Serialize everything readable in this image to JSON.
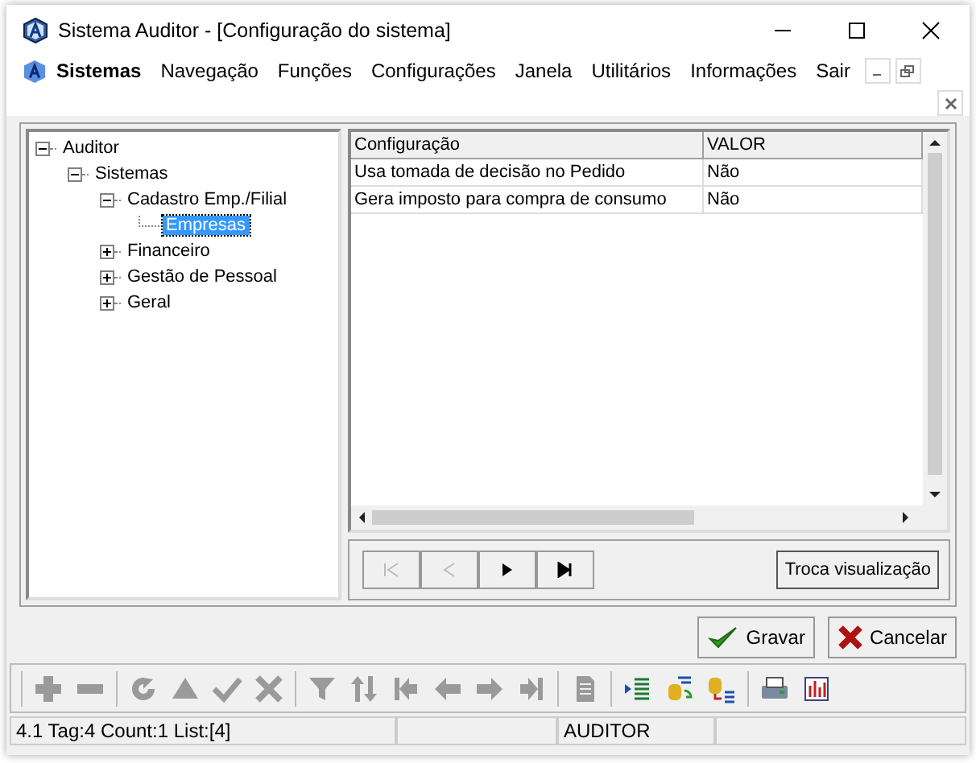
{
  "window": {
    "title": "Sistema Auditor - [Configuração do sistema]"
  },
  "menu": [
    {
      "label": "Sistemas",
      "bold": true
    },
    {
      "label": "Navegação",
      "bold": false
    },
    {
      "label": "Funções",
      "bold": false
    },
    {
      "label": "Configurações",
      "bold": false
    },
    {
      "label": "Janela",
      "bold": false
    },
    {
      "label": "Utilitários",
      "bold": false
    },
    {
      "label": "Informações",
      "bold": false
    },
    {
      "label": "Sair",
      "bold": false
    }
  ],
  "tree": [
    {
      "label": "Auditor",
      "expanded": true,
      "selected": false,
      "children": [
        {
          "label": "Sistemas",
          "expanded": true,
          "selected": false,
          "children": [
            {
              "label": "Cadastro Emp./Filial",
              "expanded": true,
              "selected": false,
              "children": [
                {
                  "label": "Empresas",
                  "selected": true
                }
              ]
            },
            {
              "label": "Financeiro",
              "expanded": false,
              "selected": false
            },
            {
              "label": "Gestão de Pessoal",
              "expanded": false,
              "selected": false
            },
            {
              "label": "Geral",
              "expanded": false,
              "selected": false
            }
          ]
        }
      ]
    }
  ],
  "table": {
    "columns": [
      "Configuração",
      "VALOR"
    ],
    "rows": [
      [
        "Usa tomada de decisão no Pedido",
        "Não"
      ],
      [
        "Gera imposto para compra de consumo",
        "Não"
      ]
    ]
  },
  "navigator": [
    {
      "kind": "first",
      "disabled": true
    },
    {
      "kind": "prev",
      "disabled": true
    },
    {
      "kind": "next",
      "disabled": false
    },
    {
      "kind": "last",
      "disabled": false
    }
  ],
  "toggle_button": "Troca visualização",
  "actions": [
    {
      "kind": "save",
      "label": "Gravar"
    },
    {
      "kind": "cancel",
      "label": "Cancelar"
    }
  ],
  "toolbar": [
    [
      {
        "kind": "plus",
        "disabled": true
      },
      {
        "kind": "minus",
        "disabled": true
      }
    ],
    [
      {
        "kind": "refresh",
        "disabled": true
      },
      {
        "kind": "up",
        "disabled": true
      },
      {
        "kind": "check",
        "disabled": true
      },
      {
        "kind": "cross",
        "disabled": true
      }
    ],
    [
      {
        "kind": "filter",
        "disabled": true
      },
      {
        "kind": "sort",
        "disabled": true
      },
      {
        "kind": "first",
        "disabled": true
      },
      {
        "kind": "left",
        "disabled": true
      },
      {
        "kind": "right",
        "disabled": true
      },
      {
        "kind": "last",
        "disabled": true
      }
    ],
    [
      {
        "kind": "doc",
        "disabled": true
      }
    ],
    [
      {
        "kind": "list",
        "disabled": false
      },
      {
        "kind": "dbswap",
        "disabled": false
      },
      {
        "kind": "dblist",
        "disabled": false
      }
    ],
    [
      {
        "kind": "print",
        "disabled": false
      },
      {
        "kind": "chart",
        "disabled": false
      }
    ]
  ],
  "status_bar": {
    "info": "4.1 Tag:4 Count:1 List:[4]",
    "user": "AUDITOR"
  }
}
